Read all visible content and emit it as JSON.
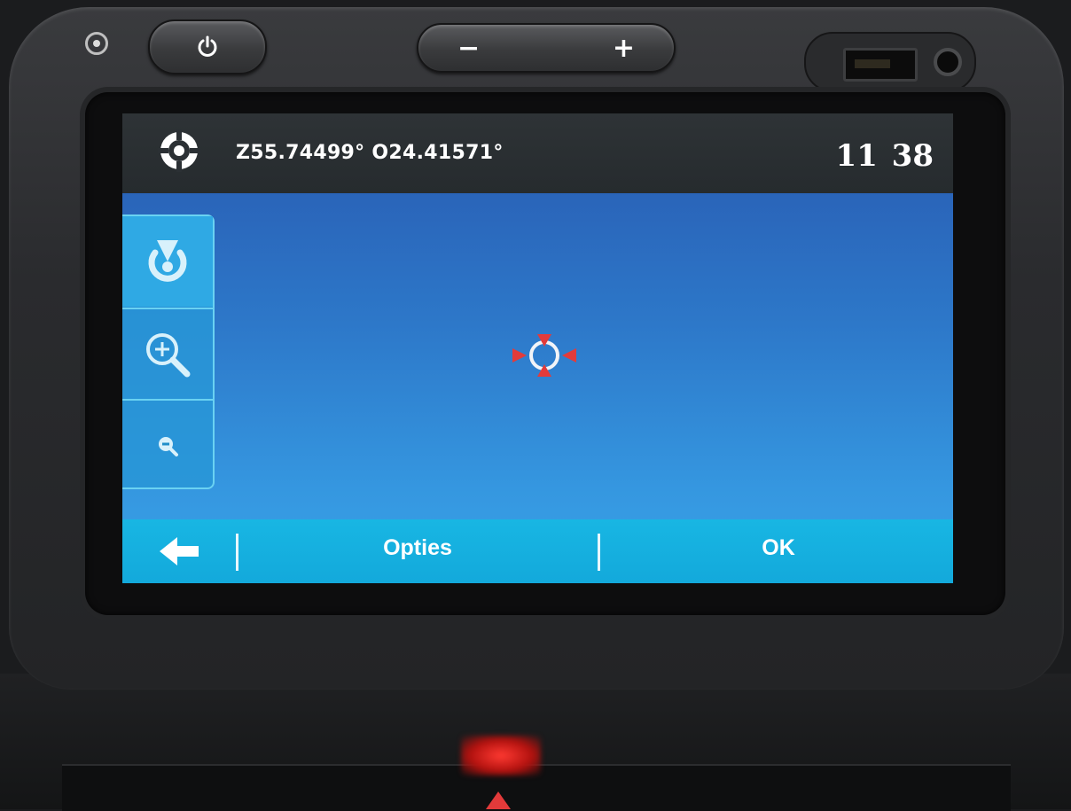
{
  "hardware": {
    "power_icon": "power-icon",
    "volume_down_label": "−",
    "volume_up_label": "+"
  },
  "status_bar": {
    "position_icon": "gps-target-icon",
    "coordinates": "Z55.74499° O24.41571°",
    "clock": "11 38"
  },
  "map_controls": {
    "items": [
      {
        "name": "center-on-position",
        "icon": "locate-icon"
      },
      {
        "name": "zoom-in",
        "icon": "zoom-in-icon"
      },
      {
        "name": "zoom-out",
        "icon": "zoom-out-icon"
      }
    ]
  },
  "map": {
    "cursor_icon": "crosshair-icon",
    "colors": {
      "sky_top": "#2a63b8",
      "sky_bottom": "#3aa3e8",
      "cursor": "#e23b3b"
    }
  },
  "bottom_bar": {
    "back_icon": "back-arrow-icon",
    "options_label": "Opties",
    "ok_label": "OK",
    "color": "#18b6e3"
  }
}
